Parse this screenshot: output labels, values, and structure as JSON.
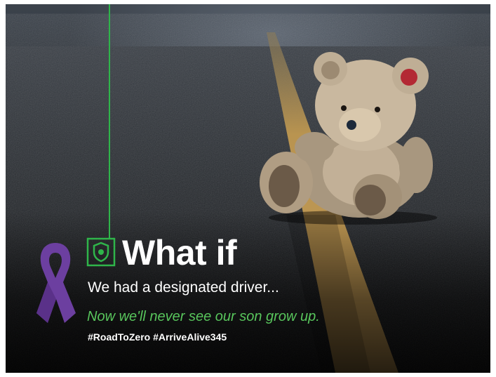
{
  "poster": {
    "headline": "What if",
    "subline": "We had a designated driver...",
    "tagline": "Now we'll never see our son grow up.",
    "hashtags": "#RoadToZero #ArriveAlive345"
  },
  "colors": {
    "accent_green": "#2fb54a",
    "tagline_green": "#58c55c",
    "ribbon_purple": "#6c3fa0",
    "road_line_yellow": "#b99450",
    "text_white": "#ffffff"
  },
  "icons": [
    "shield-icon",
    "awareness-ribbon-icon"
  ],
  "image_subject": "teddy-bear-on-road"
}
